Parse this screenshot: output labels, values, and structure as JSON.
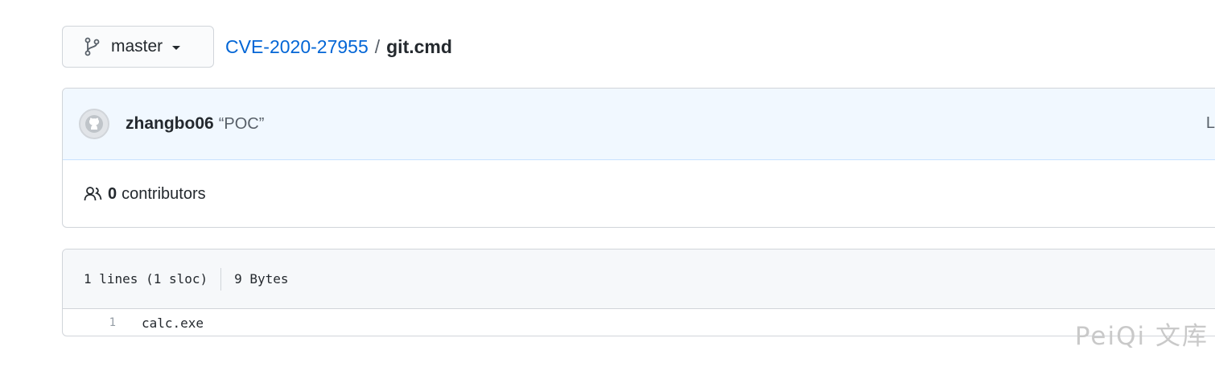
{
  "branch": {
    "label": "master"
  },
  "breadcrumb": {
    "repo": "CVE-2020-27955",
    "separator": "/",
    "file": "git.cmd"
  },
  "commit": {
    "author": "zhangbo06",
    "message": "“POC”",
    "latest_prefix": "L"
  },
  "contributors": {
    "count": "0",
    "label": "contributors"
  },
  "file_info": {
    "lines": "1 lines (1 sloc)",
    "size": "9 Bytes"
  },
  "code": [
    {
      "line_number": "1",
      "text": "calc.exe"
    }
  ],
  "watermark": "PeiQi 文库",
  "colors": {
    "link": "#0366d6",
    "commit_bg": "#f1f8ff",
    "header_bg": "#f6f8fa",
    "border": "#d1d5da"
  },
  "icons": {
    "branch": "git-branch-icon",
    "avatar": "github-avatar-icon",
    "people": "people-icon"
  }
}
